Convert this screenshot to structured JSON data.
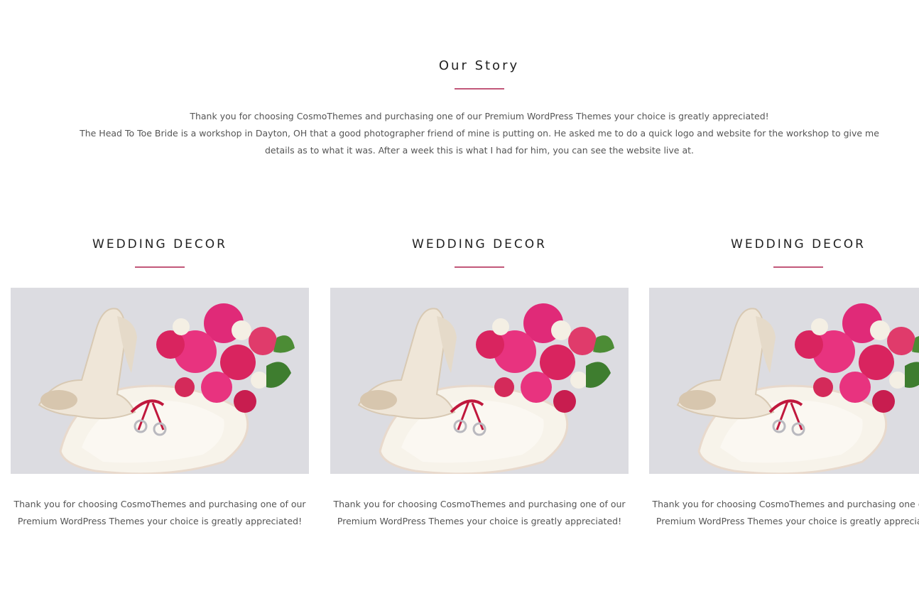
{
  "story": {
    "title": "Our Story",
    "line1": "Thank you for choosing CosmoThemes and purchasing one of our Premium WordPress Themes your choice is greatly appreciated!",
    "line2": "The Head To Toe Bride is a workshop in Dayton, OH that a good photographer friend of mine is putting on. He asked me to do a quick logo and website for the workshop to give me details as to what it was. After a week this is what I had for him, you can see the website live at."
  },
  "cards": [
    {
      "title": "WEDDING DECOR",
      "text": "Thank you for choosing CosmoThemes and purchasing one of our Premium WordPress Themes your choice is greatly appreciated!"
    },
    {
      "title": "WEDDING DECOR",
      "text": "Thank you for choosing CosmoThemes and purchasing one of our Premium WordPress Themes your choice is greatly appreciated!"
    },
    {
      "title": "WEDDING DECOR",
      "text": "Thank you for choosing CosmoThemes and purchasing one of our Premium WordPress Themes your choice is greatly appreciated!"
    }
  ],
  "colors": {
    "accent": "#c2587a",
    "heading": "#222222",
    "body_text": "#555555"
  }
}
